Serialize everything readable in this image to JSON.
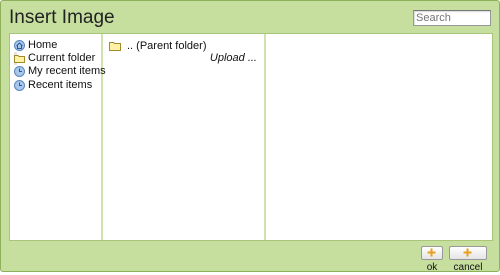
{
  "dialog": {
    "title": "Insert Image"
  },
  "search": {
    "placeholder": "Search"
  },
  "nav": {
    "items": [
      {
        "label": "Home",
        "icon": "home-icon"
      },
      {
        "label": "Current folder",
        "icon": "folder-icon",
        "selected": true
      },
      {
        "label": "My recent items",
        "icon": "recent-icon"
      },
      {
        "label": "Recent items",
        "icon": "recent-icon"
      }
    ]
  },
  "browser": {
    "parent_folder_label": ".. (Parent folder)",
    "upload_label": "Upload ..."
  },
  "buttons": {
    "ok_label": "ok",
    "cancel_label": "cancel"
  },
  "colors": {
    "dialog_bg": "#c6df9f",
    "border": "#8fb05a",
    "selected_bg": "#e3e3e3"
  }
}
